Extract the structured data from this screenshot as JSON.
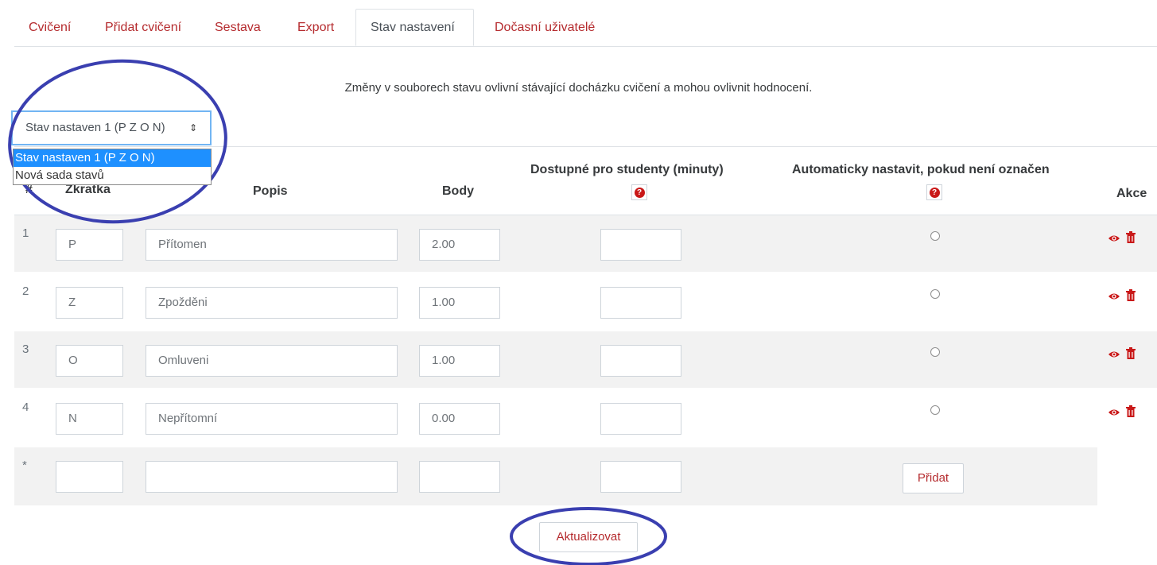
{
  "tabs": [
    "Cvičení",
    "Přidat cvičení",
    "Sestava",
    "Export",
    "Stav nastavení",
    "Dočasní uživatelé"
  ],
  "active_tab": "Stav nastavení",
  "notice": "Změny v souborech stavu ovlivní stávající docházku cvičení a mohou ovlivnit hodnocení.",
  "status_set": {
    "selected": "Stav nastaven 1 (P Z O N)",
    "options": [
      "Stav nastaven 1 (P Z O N)",
      "Nová sada stavů"
    ]
  },
  "table": {
    "headers": {
      "num": "#",
      "acronym": "Zkratka",
      "description": "Popis",
      "grade": "Body",
      "student_minutes": "Dostupné pro studenty (minuty)",
      "auto_set": "Automaticky nastavit, pokud není označen",
      "actions": "Akce"
    },
    "rows": [
      {
        "num": "1",
        "acronym": "P",
        "description": "Přítomen",
        "grade": "2.00",
        "minutes": ""
      },
      {
        "num": "2",
        "acronym": "Z",
        "description": "Zpožděni",
        "grade": "1.00",
        "minutes": ""
      },
      {
        "num": "3",
        "acronym": "O",
        "description": "Omluveni",
        "grade": "1.00",
        "minutes": ""
      },
      {
        "num": "4",
        "acronym": "N",
        "description": "Nepřítomní",
        "grade": "0.00",
        "minutes": ""
      }
    ],
    "new_row": {
      "num": "*",
      "add_label": "Přidat"
    }
  },
  "update_label": "Aktualizovat",
  "colors": {
    "link": "#b52b2e",
    "help": "#c91818",
    "annotation": "#3a3fb0",
    "row_shade": "#f2f2f2"
  }
}
